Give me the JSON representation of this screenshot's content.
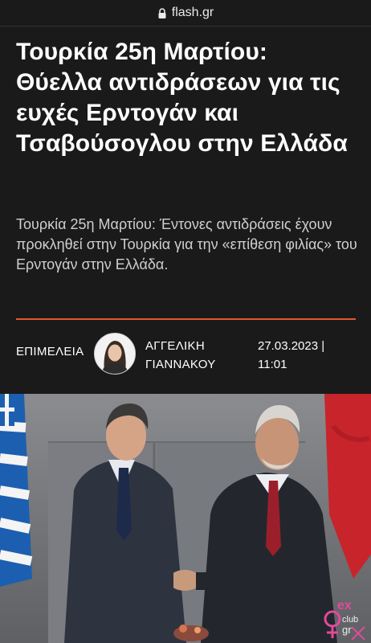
{
  "browser": {
    "url": "flash.gr"
  },
  "article": {
    "headline": "Τουρκία 25η Μαρτίου: Θύελλα αντιδράσεων για τις ευχές Ερντογάν και Τσαβούσογλου στην Ελλάδα",
    "subtitle": "Τουρκία 25η Μαρτίου: Έντονες αντιδράσεις έχουν προκληθεί στην Τουρκία για την «επίθεση φιλίας» του Ερντογάν στην Ελλάδα.",
    "byline_label": "ΕΠΙΜΕΛΕΙΑ",
    "author_first": "ΑΓΓΕΛΙΚΗ",
    "author_last": "ΓΙΑΝΝΑΚΟΥ",
    "date": "27.03.2023 |",
    "time": "11:01"
  },
  "photo": {
    "watermark": "ex club gr"
  },
  "colors": {
    "accent": "#e2572f",
    "background": "#1a1a1a"
  }
}
